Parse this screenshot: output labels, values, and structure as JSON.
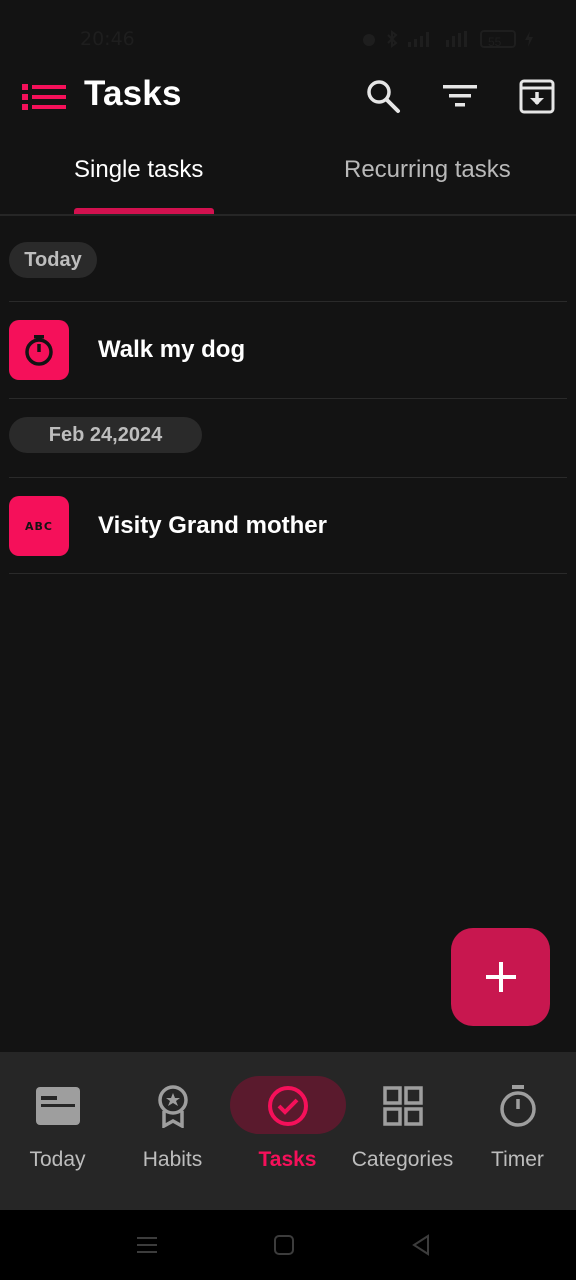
{
  "status_bar": {
    "time": "20:46",
    "battery": "55"
  },
  "app_bar": {
    "title": "Tasks",
    "menu_icon": "list-menu-icon",
    "actions": [
      "search-icon",
      "filter-icon",
      "archive-download-icon"
    ]
  },
  "tabs": [
    {
      "label": "Single tasks",
      "active": true
    },
    {
      "label": "Recurring tasks",
      "active": false
    }
  ],
  "groups": [
    {
      "date": "Today",
      "tasks": [
        {
          "title": "Walk my dog",
          "icon": "timer-icon"
        }
      ]
    },
    {
      "date": "Feb 24,2024",
      "tasks": [
        {
          "title": "Visity Grand mother",
          "icon": "abc-icon",
          "icon_text": "ABC"
        }
      ]
    }
  ],
  "fab": {
    "icon": "plus-icon"
  },
  "bottom_nav": [
    {
      "label": "Today",
      "icon": "calendar-card-icon",
      "active": false
    },
    {
      "label": "Habits",
      "icon": "award-ribbon-icon",
      "active": false
    },
    {
      "label": "Tasks",
      "icon": "check-circle-icon",
      "active": true
    },
    {
      "label": "Categories",
      "icon": "grid-icon",
      "active": false
    },
    {
      "label": "Timer",
      "icon": "stopwatch-icon",
      "active": false
    }
  ],
  "colors": {
    "accent": "#f5105a",
    "accent_dark": "#c8174f",
    "background": "#131313",
    "nav_background": "#262626",
    "chip_background": "#2a2a2a"
  }
}
